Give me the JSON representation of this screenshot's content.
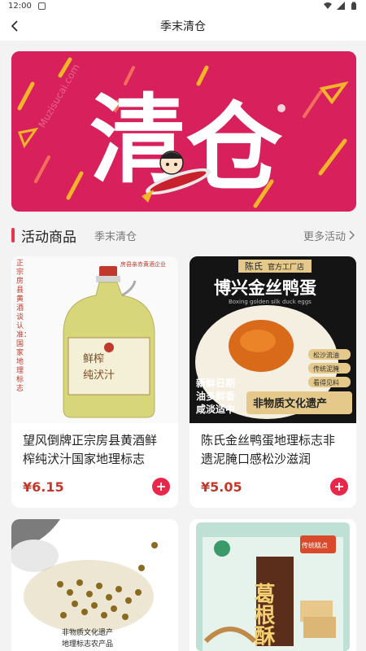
{
  "status_bar": {
    "time": "12:00"
  },
  "nav": {
    "title": "季末清仓"
  },
  "banner": {
    "headline_1": "清",
    "headline_2": "仓",
    "watermark": "Muzisucai.com"
  },
  "section": {
    "title": "活动商品",
    "subtitle": "季末清仓",
    "more": "更多活动"
  },
  "products": [
    {
      "name": "望风倒牌正宗房县黄酒鲜榨纯汱汁国家地理标志",
      "price": "¥6.15",
      "img_text": {
        "vertical": "正宗房县黄酒谈认准：国家地理标志",
        "label_1": "鲜榨",
        "label_2": "纯汱汁",
        "top": "房县亲赤黄酒企业"
      }
    },
    {
      "name": "陈氏金丝鸭蛋地理标志非遗泥腌口感松沙滋润",
      "price": "¥5.05",
      "img_text": {
        "brand": "陈氏",
        "brand_sub": "官方工厂店",
        "title": "博兴金丝鸭蛋",
        "en": "Boxing golden silk duck eggs",
        "tag_1": "新鲜日期",
        "tag_2": "油多鲜香",
        "tag_3": "咸淡适中",
        "heritage": "非物质文化遗产",
        "pill_1": "松沙流油",
        "pill_2": "传统泥腌",
        "pill_3": "看得见料"
      }
    },
    {
      "name": "",
      "price": "",
      "img_text": {
        "line_1": "非物质文化遗产",
        "line_2": "地理标志农产品"
      }
    },
    {
      "name": "",
      "price": "",
      "img_text": {
        "title": "葛根酥",
        "ribbon": "传统糕点"
      }
    }
  ]
}
